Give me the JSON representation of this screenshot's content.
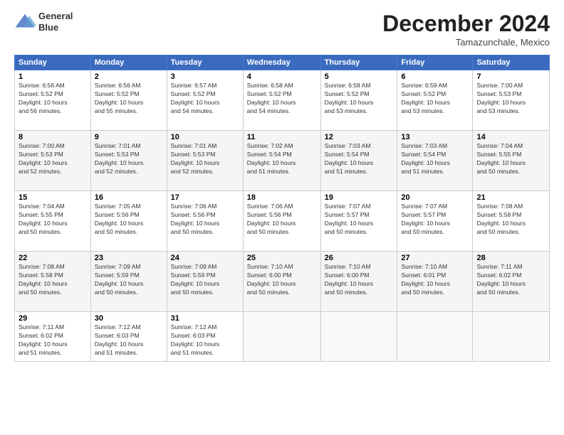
{
  "header": {
    "logo_line1": "General",
    "logo_line2": "Blue",
    "month": "December 2024",
    "location": "Tamazunchale, Mexico"
  },
  "weekdays": [
    "Sunday",
    "Monday",
    "Tuesday",
    "Wednesday",
    "Thursday",
    "Friday",
    "Saturday"
  ],
  "weeks": [
    [
      {
        "day": "1",
        "rise": "6:56 AM",
        "set": "5:52 PM",
        "hours": "10 hours",
        "min": "56"
      },
      {
        "day": "2",
        "rise": "6:56 AM",
        "set": "5:52 PM",
        "hours": "10 hours",
        "min": "55"
      },
      {
        "day": "3",
        "rise": "6:57 AM",
        "set": "5:52 PM",
        "hours": "10 hours",
        "min": "54"
      },
      {
        "day": "4",
        "rise": "6:58 AM",
        "set": "5:52 PM",
        "hours": "10 hours",
        "min": "54"
      },
      {
        "day": "5",
        "rise": "6:58 AM",
        "set": "5:52 PM",
        "hours": "10 hours",
        "min": "53"
      },
      {
        "day": "6",
        "rise": "6:59 AM",
        "set": "5:52 PM",
        "hours": "10 hours",
        "min": "53"
      },
      {
        "day": "7",
        "rise": "7:00 AM",
        "set": "5:53 PM",
        "hours": "10 hours",
        "min": "53"
      }
    ],
    [
      {
        "day": "8",
        "rise": "7:00 AM",
        "set": "5:53 PM",
        "hours": "10 hours",
        "min": "52"
      },
      {
        "day": "9",
        "rise": "7:01 AM",
        "set": "5:53 PM",
        "hours": "10 hours",
        "min": "52"
      },
      {
        "day": "10",
        "rise": "7:01 AM",
        "set": "5:53 PM",
        "hours": "10 hours",
        "min": "52"
      },
      {
        "day": "11",
        "rise": "7:02 AM",
        "set": "5:54 PM",
        "hours": "10 hours",
        "min": "51"
      },
      {
        "day": "12",
        "rise": "7:03 AM",
        "set": "5:54 PM",
        "hours": "10 hours",
        "min": "51"
      },
      {
        "day": "13",
        "rise": "7:03 AM",
        "set": "5:54 PM",
        "hours": "10 hours",
        "min": "51"
      },
      {
        "day": "14",
        "rise": "7:04 AM",
        "set": "5:55 PM",
        "hours": "10 hours",
        "min": "50"
      }
    ],
    [
      {
        "day": "15",
        "rise": "7:04 AM",
        "set": "5:55 PM",
        "hours": "10 hours",
        "min": "50"
      },
      {
        "day": "16",
        "rise": "7:05 AM",
        "set": "5:56 PM",
        "hours": "10 hours",
        "min": "50"
      },
      {
        "day": "17",
        "rise": "7:06 AM",
        "set": "5:56 PM",
        "hours": "10 hours",
        "min": "50"
      },
      {
        "day": "18",
        "rise": "7:06 AM",
        "set": "5:56 PM",
        "hours": "10 hours",
        "min": "50"
      },
      {
        "day": "19",
        "rise": "7:07 AM",
        "set": "5:57 PM",
        "hours": "10 hours",
        "min": "50"
      },
      {
        "day": "20",
        "rise": "7:07 AM",
        "set": "5:57 PM",
        "hours": "10 hours",
        "min": "50"
      },
      {
        "day": "21",
        "rise": "7:08 AM",
        "set": "5:58 PM",
        "hours": "10 hours",
        "min": "50"
      }
    ],
    [
      {
        "day": "22",
        "rise": "7:08 AM",
        "set": "5:58 PM",
        "hours": "10 hours",
        "min": "50"
      },
      {
        "day": "23",
        "rise": "7:09 AM",
        "set": "5:59 PM",
        "hours": "10 hours",
        "min": "50"
      },
      {
        "day": "24",
        "rise": "7:09 AM",
        "set": "5:59 PM",
        "hours": "10 hours",
        "min": "50"
      },
      {
        "day": "25",
        "rise": "7:10 AM",
        "set": "6:00 PM",
        "hours": "10 hours",
        "min": "50"
      },
      {
        "day": "26",
        "rise": "7:10 AM",
        "set": "6:00 PM",
        "hours": "10 hours",
        "min": "50"
      },
      {
        "day": "27",
        "rise": "7:10 AM",
        "set": "6:01 PM",
        "hours": "10 hours",
        "min": "50"
      },
      {
        "day": "28",
        "rise": "7:11 AM",
        "set": "6:02 PM",
        "hours": "10 hours",
        "min": "50"
      }
    ],
    [
      {
        "day": "29",
        "rise": "7:11 AM",
        "set": "6:02 PM",
        "hours": "10 hours",
        "min": "51"
      },
      {
        "day": "30",
        "rise": "7:12 AM",
        "set": "6:03 PM",
        "hours": "10 hours",
        "min": "51"
      },
      {
        "day": "31",
        "rise": "7:12 AM",
        "set": "6:03 PM",
        "hours": "10 hours",
        "min": "51"
      },
      null,
      null,
      null,
      null
    ]
  ]
}
